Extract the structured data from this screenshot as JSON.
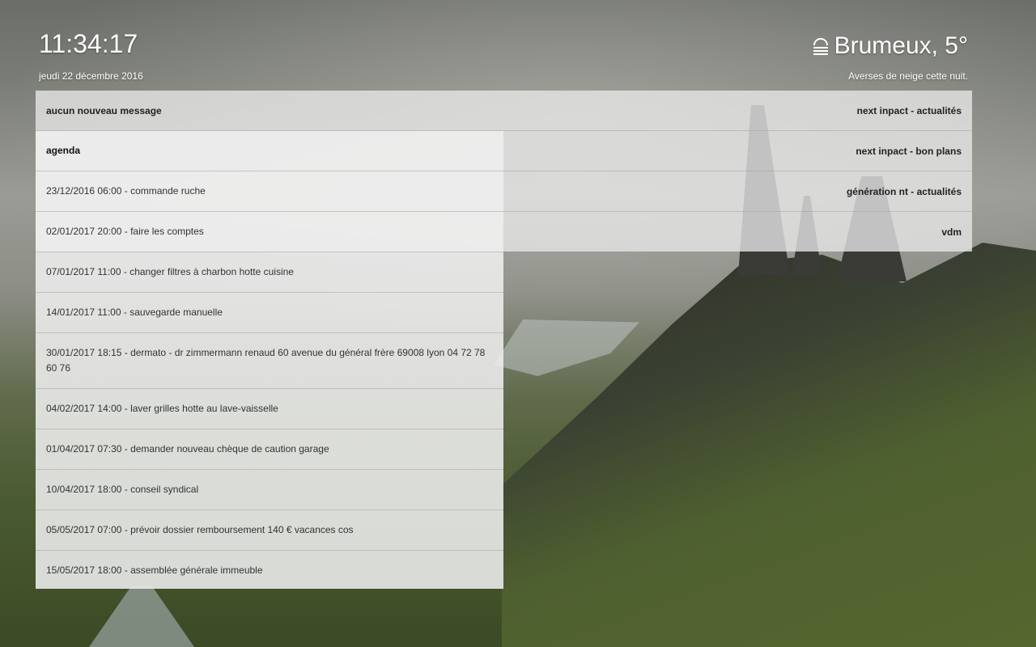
{
  "clock": {
    "time": "11:34:17",
    "date": "jeudi 22 décembre 2016"
  },
  "weather": {
    "icon": "fog-icon",
    "condition": "Brumeux, 5°",
    "forecast": "Averses de neige cette nuit."
  },
  "messages": {
    "status": "aucun nouveau message"
  },
  "feeds": [
    "next inpact - actualités",
    "next inpact - bon plans",
    "génération nt - actualités",
    "vdm"
  ],
  "agenda": {
    "title": "agenda",
    "events": [
      "23/12/2016 06:00 - commande ruche",
      "02/01/2017 20:00 - faire les comptes",
      "07/01/2017 11:00 - changer filtres à charbon hotte cuisine",
      "14/01/2017 11:00 - sauvegarde manuelle",
      "30/01/2017 18:15 - dermato - dr zimmermann renaud 60 avenue du général frère 69008 lyon 04 72 78 60 76",
      "04/02/2017 14:00 - laver grilles hotte au lave-vaisselle",
      "01/04/2017 07:30 - demander nouveau chèque de caution garage",
      "10/04/2017 18:00 - conseil syndical",
      "05/05/2017 07:00 - prévoir dossier remboursement 140 € vacances cos",
      "15/05/2017 18:00 - assemblée générale immeuble"
    ]
  }
}
